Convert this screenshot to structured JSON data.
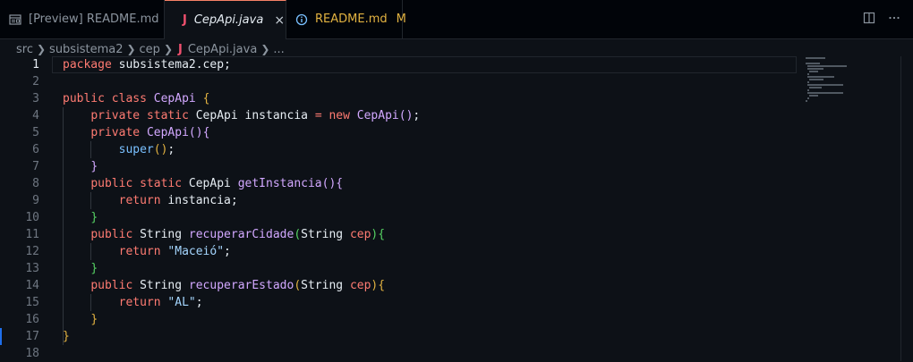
{
  "tabs": [
    {
      "label": "[Preview] README.md",
      "icon": "preview-icon"
    },
    {
      "label": "CepApi.java",
      "icon": "java-icon",
      "icon_glyph": "J",
      "close": "×"
    },
    {
      "label": "README.md",
      "icon": "info-icon",
      "badge": "M"
    }
  ],
  "breadcrumb": {
    "items": [
      "src",
      "subsistema2",
      "cep",
      "CepApi.java",
      "..."
    ],
    "file_icon": "J"
  },
  "editor": {
    "active_line": 1,
    "line_numbers": [
      "1",
      "2",
      "3",
      "4",
      "5",
      "6",
      "7",
      "8",
      "9",
      "10",
      "11",
      "12",
      "13",
      "14",
      "15",
      "16",
      "17",
      "18"
    ]
  },
  "code": {
    "l1": {
      "kw": "package",
      "rest": " subsistema2.cep;"
    },
    "l3": {
      "kw1": "public",
      "kw2": "class",
      "name": "CepApi",
      "brace": "{"
    },
    "l4": {
      "kw1": "private",
      "kw2": "static",
      "type": "CepApi",
      "var": "instancia",
      "eq": "=",
      "kw3": "new",
      "ctor": "CepApi",
      "paren": "()",
      "semi": ";"
    },
    "l5": {
      "kw1": "private",
      "name": "CepApi",
      "paren": "()",
      "brace": "{"
    },
    "l6": {
      "name": "super",
      "paren": "()",
      "semi": ";"
    },
    "l7": {
      "brace": "}"
    },
    "l8": {
      "kw1": "public",
      "kw2": "static",
      "type": "CepApi",
      "name": "getInstancia",
      "paren": "()",
      "brace": "{"
    },
    "l9": {
      "kw": "return",
      "rest": " instancia;"
    },
    "l10": {
      "brace": "}"
    },
    "l11": {
      "kw1": "public",
      "type": "String",
      "name": "recuperarCidade",
      "open": "(",
      "ptype": "String",
      "pname": "cep",
      "close": ")",
      "brace": "{"
    },
    "l12": {
      "kw": "return",
      "str": "\"Maceió\"",
      "semi": ";"
    },
    "l13": {
      "brace": "}"
    },
    "l14": {
      "kw1": "public",
      "type": "String",
      "name": "recuperarEstado",
      "open": "(",
      "ptype": "String",
      "pname": "cep",
      "close": ")",
      "brace": "{"
    },
    "l15": {
      "kw": "return",
      "str": "\"AL\"",
      "semi": ";"
    },
    "l16": {
      "brace": "}"
    },
    "l17": {
      "brace": "}"
    }
  },
  "colors": {
    "background": "#0d1117",
    "keyword": "#ff7b72",
    "function": "#d2a8ff",
    "string": "#a5d6ff",
    "active_tab_border": "#f78166",
    "modified": "#e3b341"
  }
}
